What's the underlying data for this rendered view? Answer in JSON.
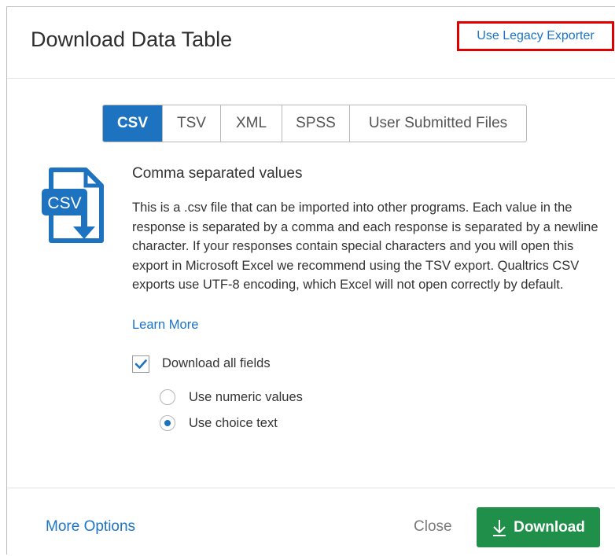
{
  "dialog": {
    "title": "Download Data Table",
    "legacy_link": "Use Legacy Exporter"
  },
  "tabs": [
    {
      "label": "CSV",
      "active": true
    },
    {
      "label": "TSV",
      "active": false
    },
    {
      "label": "XML",
      "active": false
    },
    {
      "label": "SPSS",
      "active": false
    },
    {
      "label": "User Submitted Files",
      "active": false
    }
  ],
  "format": {
    "icon": "csv-file-download-icon",
    "icon_text": "CSV",
    "title": "Comma separated values",
    "description": "This is a .csv file that can be imported into other programs. Each value in the response is separated by a comma and each response is separated by a newline character. If your responses contain special characters and you will open this export in Microsoft Excel we recommend using the TSV export. Qualtrics CSV exports use UTF-8 encoding, which Excel will not open correctly by default.",
    "learn_more": "Learn More"
  },
  "options": {
    "download_all_fields": {
      "label": "Download all fields",
      "checked": true
    },
    "value_format": {
      "numeric": {
        "label": "Use numeric values",
        "selected": false
      },
      "choice_text": {
        "label": "Use choice text",
        "selected": true
      }
    }
  },
  "footer": {
    "more_options": "More Options",
    "close": "Close",
    "download": "Download"
  },
  "colors": {
    "accent": "#1d73bf",
    "link": "#1b74c4",
    "download": "#1f8f4a",
    "highlight_border": "#e00000"
  }
}
